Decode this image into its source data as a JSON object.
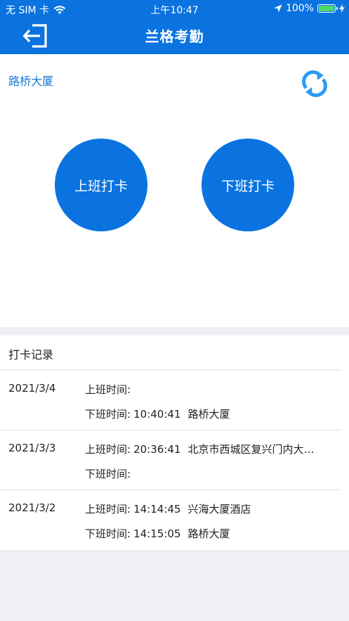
{
  "status_bar": {
    "carrier": "无 SIM 卡",
    "time": "上午10:47",
    "battery": "100%",
    "battery_level": 1.0
  },
  "navbar": {
    "title": "兰格考勤",
    "back_icon": "logout-icon"
  },
  "location": {
    "name": "路桥大厦",
    "refresh_icon": "refresh-icon"
  },
  "punch": {
    "in_label": "上班打卡",
    "out_label": "下班打卡"
  },
  "records": {
    "title": "打卡记录",
    "in_label": "上班时间:",
    "out_label": "下班时间:",
    "items": [
      {
        "date": "2021/3/4",
        "in_time": "",
        "in_place": "",
        "out_time": "10:40:41",
        "out_place": "路桥大厦"
      },
      {
        "date": "2021/3/3",
        "in_time": "20:36:41",
        "in_place": "北京市西城区复兴门内大…",
        "out_time": "",
        "out_place": ""
      },
      {
        "date": "2021/3/2",
        "in_time": "14:14:45",
        "in_place": "兴海大厦酒店",
        "out_time": "14:15:05",
        "out_place": "路桥大厦"
      }
    ]
  },
  "colors": {
    "primary": "#0a73e0",
    "link": "#1a7ad6",
    "refresh": "#2b9af3",
    "battery": "#4cd964"
  }
}
